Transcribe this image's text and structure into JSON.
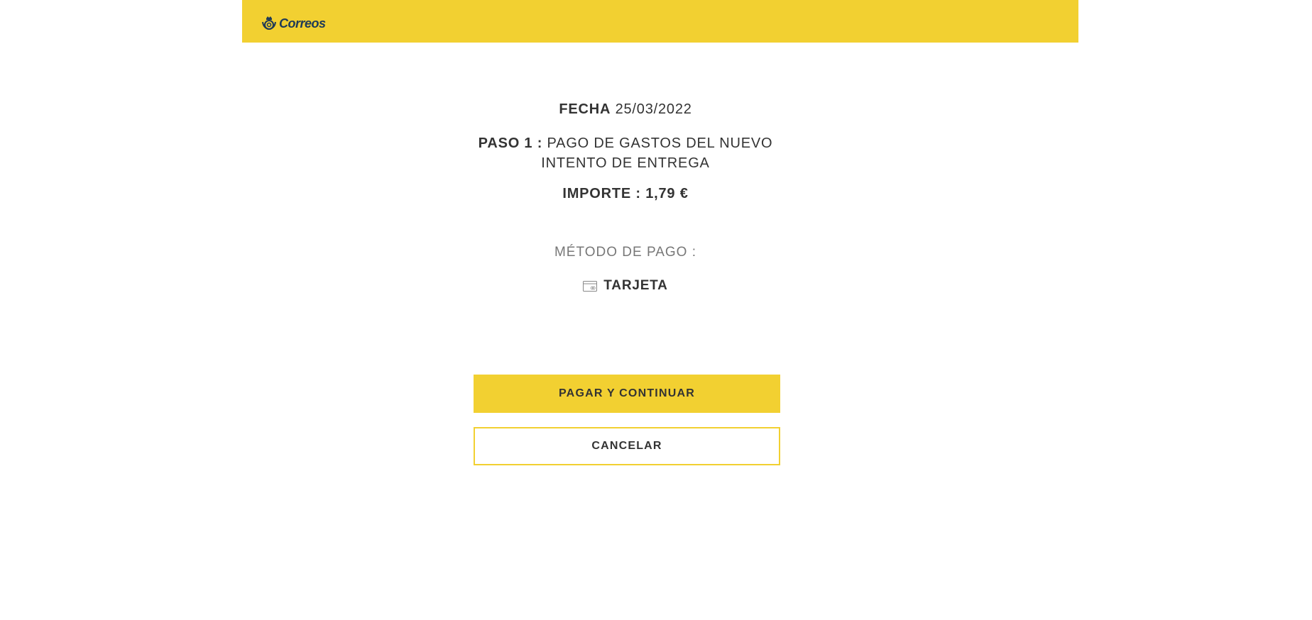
{
  "header": {
    "logo_text": "Correos",
    "logo_icon": "posthorn-crown-icon"
  },
  "summary": {
    "fecha_label": "FECHA",
    "fecha_value": "25/03/2022",
    "paso_label": "PASO 1 :",
    "paso_value": "PAGO DE GASTOS DEL NUEVO INTENTO DE ENTREGA",
    "importe": "IMPORTE : 1,79 €"
  },
  "payment": {
    "method_label": "MÉTODO DE PAGO :",
    "method_icon": "credit-card-icon",
    "method_value": "TARJETA"
  },
  "actions": {
    "pay_label": "PAGAR Y CONTINUAR",
    "cancel_label": "CANCELAR"
  },
  "colors": {
    "brand_yellow": "#f2d031",
    "logo_blue": "#1f3a57",
    "text_dark": "#333333",
    "text_muted": "#777777"
  }
}
